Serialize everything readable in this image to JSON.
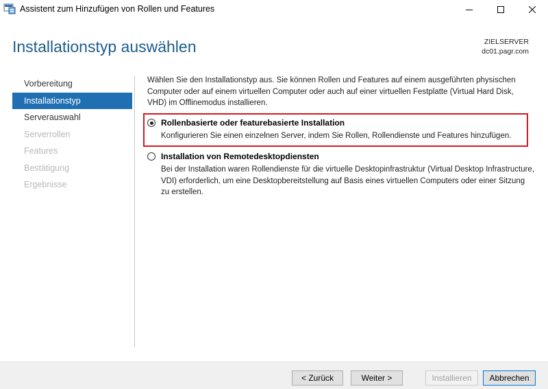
{
  "window": {
    "title": "Assistent zum Hinzufügen von Rollen und Features",
    "icon": "server-manager-icon"
  },
  "header": {
    "page_title": "Installationstyp auswählen",
    "server_label": "ZIELSERVER",
    "server_name": "dc01.pagr.com"
  },
  "nav": {
    "items": [
      {
        "label": "Vorbereitung",
        "state": "normal"
      },
      {
        "label": "Installationstyp",
        "state": "active"
      },
      {
        "label": "Serverauswahl",
        "state": "normal"
      },
      {
        "label": "Serverrollen",
        "state": "disabled"
      },
      {
        "label": "Features",
        "state": "disabled"
      },
      {
        "label": "Bestätigung",
        "state": "disabled"
      },
      {
        "label": "Ergebnisse",
        "state": "disabled"
      }
    ]
  },
  "content": {
    "intro": "Wählen Sie den Installationstyp aus. Sie können Rollen und Features auf einem ausgeführten physischen Computer oder auf einem virtuellen Computer oder auch auf einer virtuellen Festplatte (Virtual Hard Disk, VHD) im Offlinemodus installieren.",
    "options": [
      {
        "title": "Rollenbasierte oder featurebasierte Installation",
        "description": "Konfigurieren Sie einen einzelnen Server, indem Sie Rollen, Rollendienste und Features hinzufügen.",
        "selected": true
      },
      {
        "title": "Installation von Remotedesktopdiensten",
        "description": "Bei der Installation waren Rollendienste für die virtuelle Desktopinfrastruktur (Virtual Desktop Infrastructure, VDI) erforderlich, um eine Desktopbereitstellung auf Basis eines virtuellen Computers oder einer Sitzung zu erstellen.",
        "selected": false
      }
    ]
  },
  "footer": {
    "back_label": "< Zurück",
    "next_label": "Weiter >",
    "install_label": "Installieren",
    "cancel_label": "Abbrechen"
  },
  "colors": {
    "accent": "#1f6fb2",
    "title": "#1d5d8c",
    "highlight": "#d7171f"
  }
}
